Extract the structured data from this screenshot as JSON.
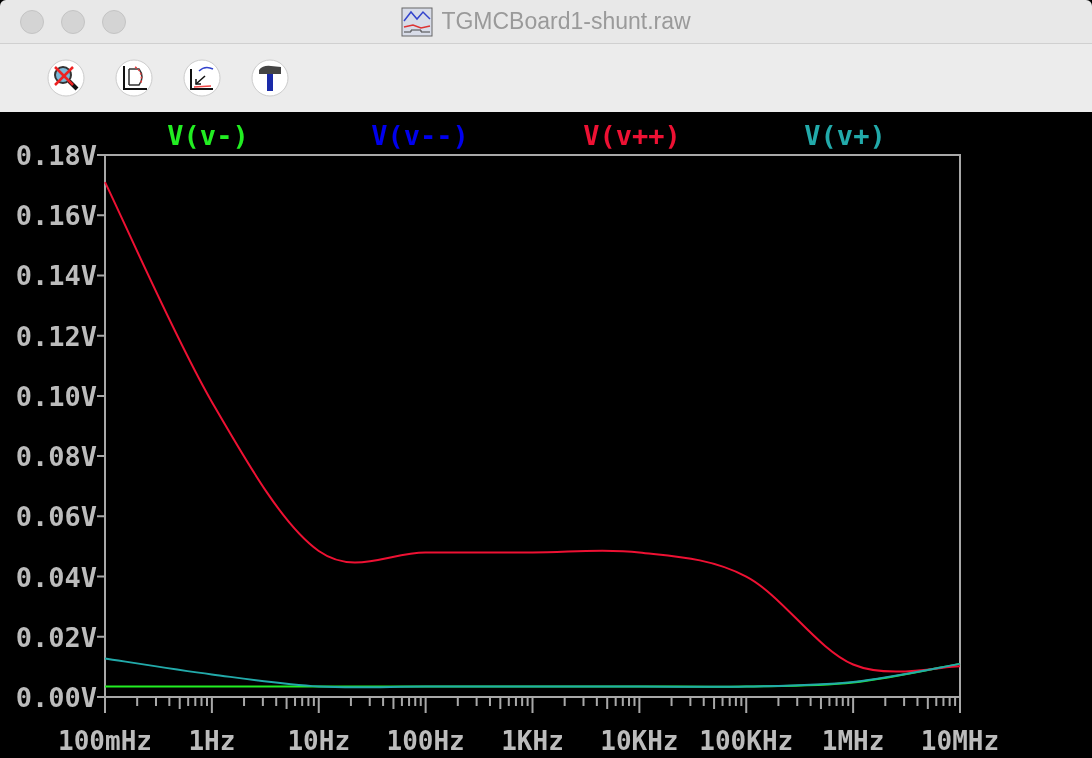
{
  "window": {
    "title": "TGMCBoard1-shunt.raw"
  },
  "plot": {
    "chart_data": {
      "type": "line",
      "categories": [
        "100mHz",
        "1Hz",
        "10Hz",
        "100Hz",
        "1KHz",
        "10KHz",
        "100KHz",
        "1MHz",
        "10MHz"
      ],
      "series": [
        {
          "name": "V(v-)",
          "color": "#22ee22",
          "values": [
            0.0035,
            0.0035,
            0.0035,
            0.0035,
            0.0035,
            0.0035,
            0.0035,
            0.0048,
            0.011
          ]
        },
        {
          "name": "V(v--)",
          "color": "#0000ee",
          "values": [
            null,
            null,
            null,
            null,
            null,
            null,
            null,
            null,
            null
          ]
        },
        {
          "name": "V(v++)",
          "color": "#ee1133",
          "values": [
            0.171,
            0.098,
            0.0485,
            0.048,
            0.048,
            0.048,
            0.04,
            0.0108,
            0.0102
          ]
        },
        {
          "name": "V(v+)",
          "color": "#22aaaa",
          "values": [
            0.0128,
            0.0075,
            0.0035,
            0.0035,
            0.0035,
            0.0035,
            0.0035,
            0.005,
            0.011
          ]
        }
      ],
      "ylim": [
        0,
        0.18
      ],
      "yticks": [
        {
          "value": 0,
          "label": "0.00V"
        },
        {
          "value": 0.02,
          "label": "0.02V"
        },
        {
          "value": 0.04,
          "label": "0.04V"
        },
        {
          "value": 0.06,
          "label": "0.06V"
        },
        {
          "value": 0.08,
          "label": "0.08V"
        },
        {
          "value": 0.1,
          "label": "0.10V"
        },
        {
          "value": 0.12,
          "label": "0.12V"
        },
        {
          "value": 0.14,
          "label": "0.14V"
        },
        {
          "value": 0.16,
          "label": "0.16V"
        },
        {
          "value": 0.18,
          "label": "0.18V"
        }
      ]
    }
  }
}
